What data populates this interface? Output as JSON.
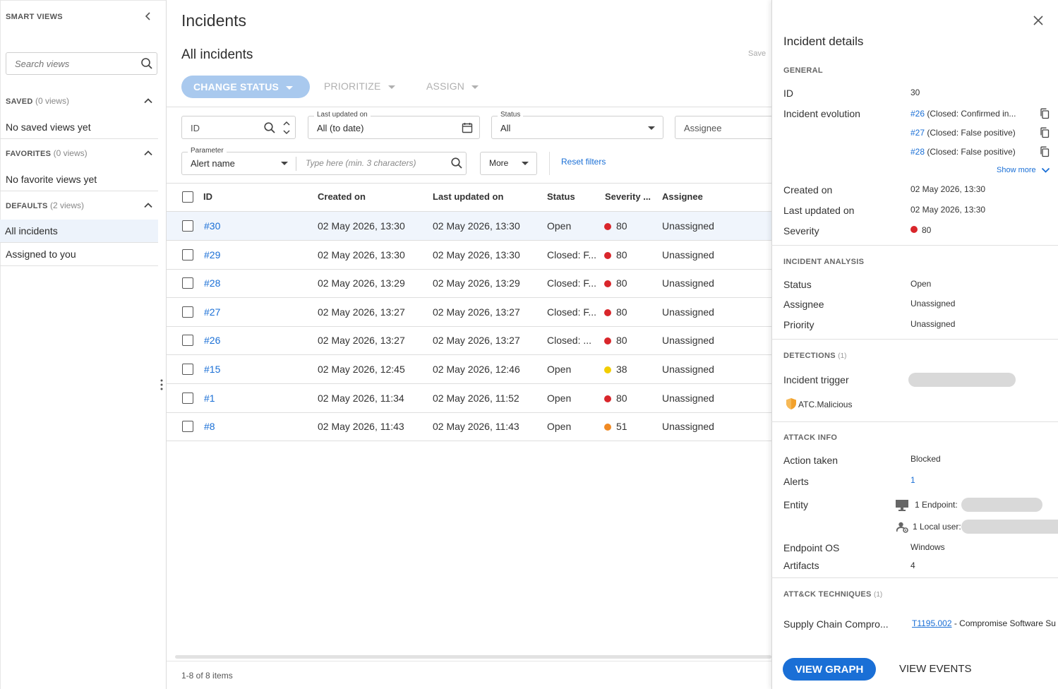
{
  "sidebar": {
    "title": "SMART VIEWS",
    "search_placeholder": "Search views",
    "sections": [
      {
        "name": "SAVED",
        "count": "(0 views)",
        "empty": "No saved views yet"
      },
      {
        "name": "FAVORITES",
        "count": "(0 views)",
        "empty": "No favorite views yet"
      },
      {
        "name": "DEFAULTS",
        "count": "(2 views)",
        "items": [
          "All incidents",
          "Assigned to you"
        ]
      }
    ]
  },
  "header": {
    "title": "Incidents",
    "subtitle": "All incidents",
    "save_label": "Save"
  },
  "toolbar": {
    "change_status": "CHANGE STATUS",
    "prioritize": "PRIORITIZE",
    "assign": "ASSIGN"
  },
  "filters": {
    "id_placeholder": "ID",
    "last_updated_label": "Last updated on",
    "last_updated_value": "All (to date)",
    "status_label": "Status",
    "status_value": "All",
    "assignee_placeholder": "Assignee",
    "parameter_label": "Parameter",
    "parameter_value": "Alert name",
    "parameter_search_placeholder": "Type here (min. 3 characters)",
    "more_label": "More",
    "reset_label": "Reset filters"
  },
  "table": {
    "columns": [
      "ID",
      "Created on",
      "Last updated on",
      "Status",
      "Severity ...",
      "Assignee"
    ],
    "rows": [
      {
        "id": "#30",
        "created": "02 May 2026, 13:30",
        "updated": "02 May 2026, 13:30",
        "status": "Open",
        "severity": "80",
        "sev_color": "#d9262b",
        "assignee": "Unassigned"
      },
      {
        "id": "#29",
        "created": "02 May 2026, 13:30",
        "updated": "02 May 2026, 13:30",
        "status": "Closed: F...",
        "severity": "80",
        "sev_color": "#d9262b",
        "assignee": "Unassigned"
      },
      {
        "id": "#28",
        "created": "02 May 2026, 13:29",
        "updated": "02 May 2026, 13:29",
        "status": "Closed: F...",
        "severity": "80",
        "sev_color": "#d9262b",
        "assignee": "Unassigned"
      },
      {
        "id": "#27",
        "created": "02 May 2026, 13:27",
        "updated": "02 May 2026, 13:27",
        "status": "Closed: F...",
        "severity": "80",
        "sev_color": "#d9262b",
        "assignee": "Unassigned"
      },
      {
        "id": "#26",
        "created": "02 May 2026, 13:27",
        "updated": "02 May 2026, 13:27",
        "status": "Closed: ...",
        "severity": "80",
        "sev_color": "#d9262b",
        "assignee": "Unassigned"
      },
      {
        "id": "#15",
        "created": "02 May 2026, 12:45",
        "updated": "02 May 2026, 12:46",
        "status": "Open",
        "severity": "38",
        "sev_color": "#f2cd00",
        "assignee": "Unassigned"
      },
      {
        "id": "#1",
        "created": "02 May 2026, 11:34",
        "updated": "02 May 2026, 11:52",
        "status": "Open",
        "severity": "80",
        "sev_color": "#d9262b",
        "assignee": "Unassigned"
      },
      {
        "id": "#8",
        "created": "02 May 2026, 11:43",
        "updated": "02 May 2026, 11:43",
        "status": "Open",
        "severity": "51",
        "sev_color": "#f08a24",
        "assignee": "Unassigned"
      }
    ],
    "footer": "1-8 of 8 items"
  },
  "details": {
    "title": "Incident details",
    "general_header": "GENERAL",
    "id_label": "ID",
    "id_value": "30",
    "evolution_label": "Incident evolution",
    "evolution": [
      {
        "id": "#26",
        "text": "(Closed: Confirmed in..."
      },
      {
        "id": "#27",
        "text": "(Closed: False positive)"
      },
      {
        "id": "#28",
        "text": "(Closed: False positive)"
      }
    ],
    "show_more": "Show more",
    "created_label": "Created on",
    "created_value": "02 May 2026, 13:30",
    "updated_label": "Last updated on",
    "updated_value": "02 May 2026, 13:30",
    "severity_label": "Severity",
    "severity_value": "80",
    "severity_color": "#d9262b",
    "analysis_header": "INCIDENT ANALYSIS",
    "status_label": "Status",
    "status_value": "Open",
    "assignee_label": "Assignee",
    "assignee_value": "Unassigned",
    "priority_label": "Priority",
    "priority_value": "Unassigned",
    "detections_header": "DETECTIONS",
    "detections_count": "(1)",
    "trigger_label": "Incident trigger",
    "trigger_name": "ATC.Malicious",
    "attack_header": "ATTACK INFO",
    "action_label": "Action taken",
    "action_value": "Blocked",
    "alerts_label": "Alerts",
    "alerts_value": "1",
    "entity_label": "Entity",
    "entity_endpoint": "1 Endpoint:",
    "entity_user": "1 Local user:",
    "os_label": "Endpoint OS",
    "os_value": "Windows",
    "artifacts_label": "Artifacts",
    "artifacts_value": "4",
    "attck_header": "ATT&CK TECHNIQUES",
    "attck_count": "(1)",
    "technique_label": "Supply Chain Compro...",
    "technique_id": "T1195.002",
    "technique_desc": "- Compromise Software Su",
    "view_graph": "VIEW GRAPH",
    "view_events": "VIEW EVENTS"
  }
}
